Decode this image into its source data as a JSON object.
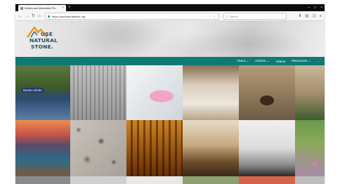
{
  "browser": {
    "tab_title": "Articles and Information Pro",
    "tab_close": "×",
    "new_tab": "+",
    "url": "https://usenaturalstone.org",
    "url_actions": "··· ♡ ☆",
    "search_placeholder": "Search",
    "window_buttons": [
      "–",
      "□",
      "×"
    ]
  },
  "logo": {
    "line1": "USE",
    "line2": "NATURAL",
    "line3": "STONE."
  },
  "menu": {
    "items": [
      "About ⌄",
      "Articles ⌄",
      "Videos",
      "Resources ⌄",
      "···"
    ]
  },
  "tiles": {
    "t1_badge": "Boston Globe"
  },
  "colors": {
    "menu_bg": "#0f7a73",
    "logo_text": "#1d4e6b",
    "logo_mountain": "#e79a1d"
  }
}
